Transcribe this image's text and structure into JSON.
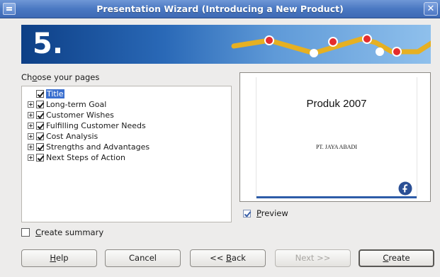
{
  "window": {
    "title": "Presentation Wizard (Introducing a New Product)",
    "close_glyph": "✕"
  },
  "banner": {
    "step_label": "5."
  },
  "pages_section": {
    "label_prefix": "Ch",
    "label_access": "o",
    "label_suffix": "ose your pages",
    "items": [
      {
        "label": "Title",
        "checked": true,
        "expandable": false,
        "selected": true
      },
      {
        "label": "Long-term Goal",
        "checked": true,
        "expandable": true,
        "selected": false
      },
      {
        "label": "Customer Wishes",
        "checked": true,
        "expandable": true,
        "selected": false
      },
      {
        "label": "Fulfilling Customer Needs",
        "checked": true,
        "expandable": true,
        "selected": false
      },
      {
        "label": "Cost Analysis",
        "checked": true,
        "expandable": true,
        "selected": false
      },
      {
        "label": "Strengths and Advantages",
        "checked": true,
        "expandable": true,
        "selected": false
      },
      {
        "label": "Next Steps of Action",
        "checked": true,
        "expandable": true,
        "selected": false
      }
    ]
  },
  "preview": {
    "slide_title": "Produk 2007",
    "slide_subtitle": "PT. JAYA ABADI",
    "checkbox_access": "P",
    "checkbox_rest": "review",
    "checked": true,
    "logo_icon": "fedora-logo-icon"
  },
  "summary": {
    "access": "C",
    "rest": "reate summary",
    "checked": false
  },
  "buttons": {
    "help_access": "H",
    "help_rest": "elp",
    "cancel": "Cancel",
    "back_prefix": "<< ",
    "back_access": "B",
    "back_rest": "ack",
    "next": "Next >>",
    "create_access": "C",
    "create_rest": "reate"
  },
  "colors": {
    "titlebar": "#4a78c2",
    "banner_dark": "#0d3f86",
    "selection": "#3a6fcf",
    "slide_accent": "#2d5ca8"
  }
}
